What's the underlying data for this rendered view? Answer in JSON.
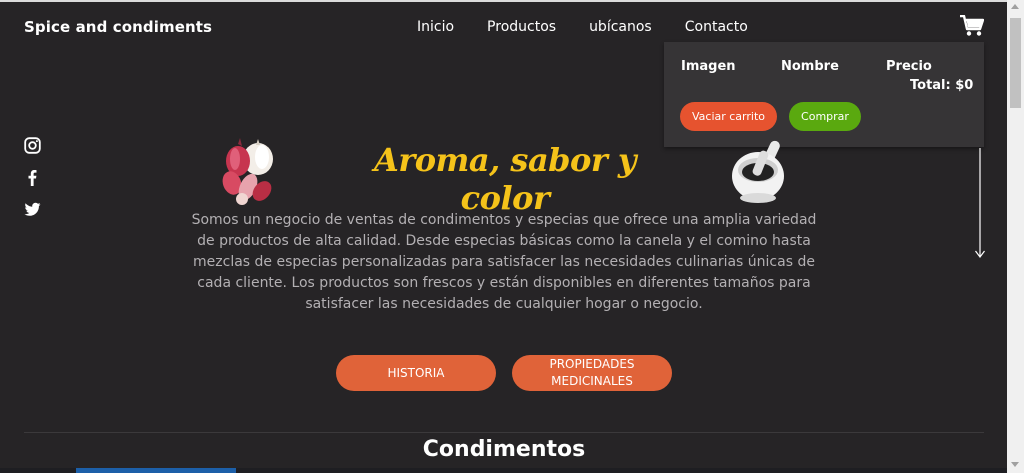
{
  "brand": "Spice and condiments",
  "nav": {
    "items": [
      "Inicio",
      "Productos",
      "ubícanos",
      "Contacto"
    ]
  },
  "cart": {
    "col_image": "Imagen",
    "col_name": "Nombre",
    "col_price": "Precio",
    "total": "Total: $0",
    "empty_label": "Vaciar carrito",
    "buy_label": "Comprar"
  },
  "hero": {
    "title": "Aroma, sabor y color",
    "description": "Somos un negocio de ventas de condimentos y especias que ofrece una amplia variedad de productos de alta calidad. Desde especias básicas como la canela y el comino hasta mezclas de especias personalizadas para satisfacer las necesidades culinarias únicas de cada cliente. Los productos son frescos y están disponibles en diferentes tamaños para satisfacer las necesidades de cualquier hogar o negocio.",
    "btn_history": "HISTORIA",
    "btn_properties": "PROPIEDADES MEDICINALES"
  },
  "section": {
    "title": "Condimentos"
  },
  "icons": {
    "cart": "shopping-cart-icon",
    "instagram": "instagram-icon",
    "facebook": "facebook-icon",
    "twitter": "twitter-icon",
    "arrow": "arrow-down-icon"
  },
  "colors": {
    "background": "#262426",
    "accent_title": "#f5c31a",
    "orange": "#e06339",
    "green": "#5aa90f",
    "cart_bg": "#363436"
  }
}
